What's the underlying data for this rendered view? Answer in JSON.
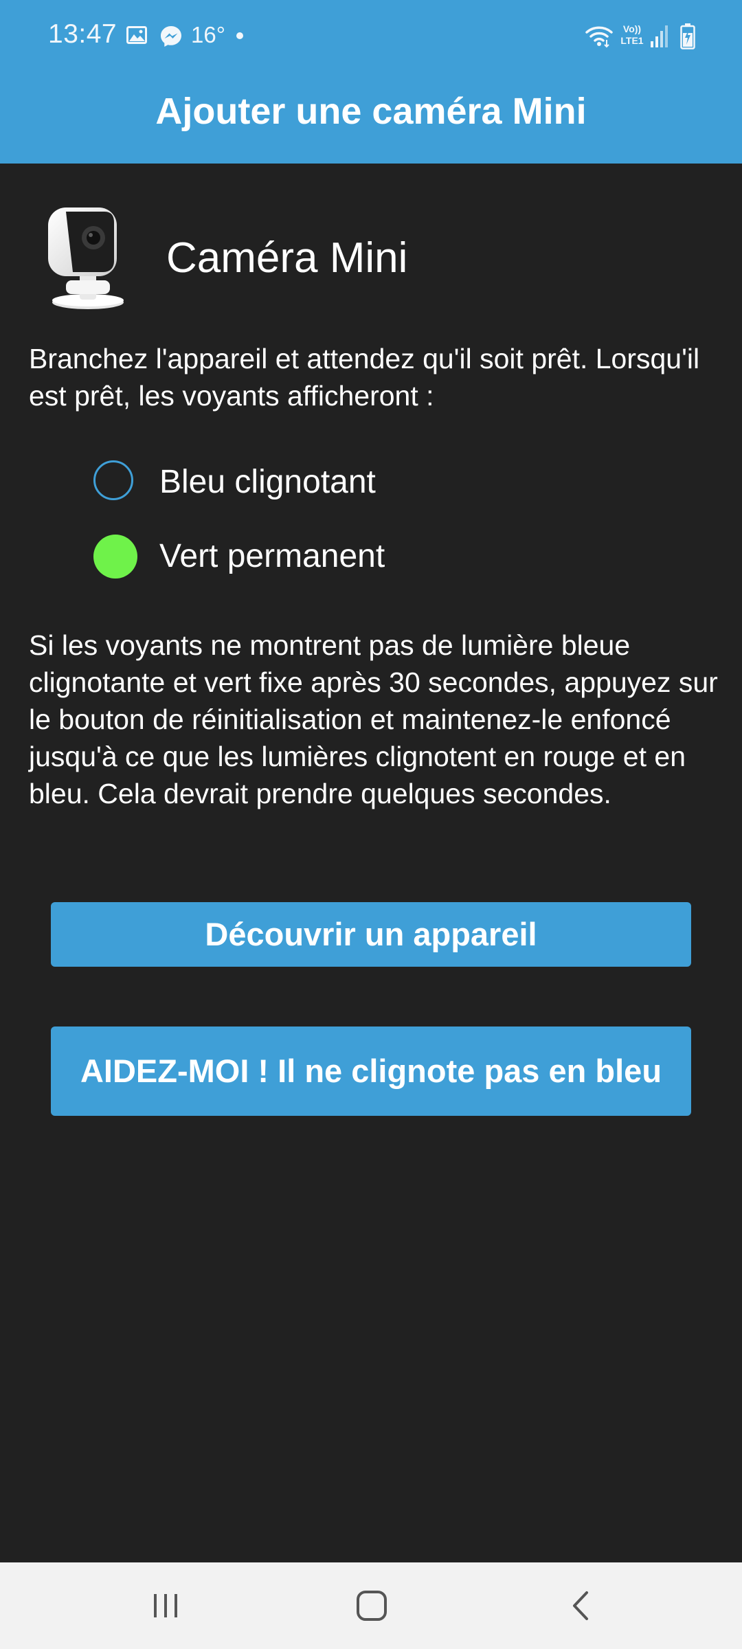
{
  "status_bar": {
    "time": "13:47",
    "temperature": "16°",
    "network_label": "Vo)) LTE1",
    "icons": [
      "gallery-icon",
      "messenger-icon",
      "dot-icon",
      "wifi-icon",
      "volte-icon",
      "signal-icon",
      "battery-charging-icon"
    ]
  },
  "header": {
    "title": "Ajouter une caméra Mini"
  },
  "device": {
    "name": "Caméra Mini",
    "image_icon": "camera-mini-icon"
  },
  "instructions": {
    "intro": "Branchez l'appareil et attendez qu'il soit prêt. Lorsqu'il est prêt, les voyants afficheront :",
    "leds": [
      {
        "label": "Bleu clignotant",
        "color": "#3f9fd7",
        "style": "ring"
      },
      {
        "label": "Vert permanent",
        "color": "#6ff24a",
        "style": "solid"
      }
    ],
    "help": "Si les voyants ne montrent pas de lumière bleue clignotante et vert fixe après 30 secondes, appuyez sur le bouton de réinitialisation et maintenez-le enfoncé jusqu'à ce que les lumières clignotent en rouge et en bleu. Cela devrait prendre quelques secondes."
  },
  "buttons": {
    "discover_label": "Découvrir un appareil",
    "help_label": "AIDEZ-MOI ! Il ne clignote pas en bleu"
  },
  "nav": {
    "icons": [
      "recents-icon",
      "home-icon",
      "back-icon"
    ]
  },
  "colors": {
    "accent": "#3f9fd7",
    "background": "#212121",
    "led_green": "#6ff24a",
    "nav_background": "#f2f2f2"
  }
}
